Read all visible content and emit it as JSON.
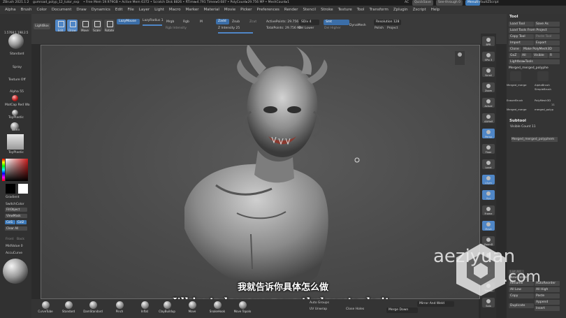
{
  "titlebar": {
    "app": "ZBrush 2021.1.2",
    "file": "gumroad_polyp_12_tutor_exp",
    "stats": "• Free Mem 19.979GB • Active Mem 6372 • Scratch Disk 8826 • RTime▸4.791 Timer▸0.687 • PolyCount▸29.756 MP • MeshCount▸1",
    "ac": "AC",
    "quicksave": "QuickSave",
    "seethrough": "See-through 0",
    "menus": "Menus",
    "defaultscript": "DefaultZScript"
  },
  "menubar": [
    "Alpha",
    "Brush",
    "Color",
    "Document",
    "Draw",
    "Dynamics",
    "Edit",
    "File",
    "Layer",
    "Light",
    "Macro",
    "Marker",
    "Material",
    "Movie",
    "Picker",
    "Preferences",
    "Render",
    "Stencil",
    "Stroke",
    "Texture",
    "Tool",
    "Transform",
    "Zplugin",
    "Zscript",
    "Help"
  ],
  "shelf": {
    "projection_master": "Projection Master",
    "lightbox": "LightBox",
    "edit": "Edit",
    "draw": "Draw",
    "move": "Move",
    "scale": "Scale",
    "rotate": "Rotate",
    "lazymouse": "LazyMouse",
    "lazyradius": "LazyRadius 1",
    "mrgb": "Mrgb",
    "rgb": "Rgb",
    "m": "M",
    "zadd": "Zadd",
    "zsub": "Zsub",
    "zcut": "Zcut",
    "z_intensity": "Z Intensity 25",
    "rgb_intensity": "Rgb Intensity",
    "activepoints": "ActivePoints: 29.756 Mil",
    "totalpoints": "TotalPoints: 29.756 Mil",
    "divide": "Divide",
    "sdiv": "SDiv 4",
    "del_lower": "Del Lower",
    "smt": "Smt",
    "del_higher": "Del Higher",
    "dynamesh": "DynaMesh",
    "resolution": "Resolution 128",
    "polish": "Polish",
    "project": "Project"
  },
  "lefttray": {
    "brush": "Standard",
    "stroke": "Spray",
    "texture": "Texture Off",
    "alpha": "Alpha 55",
    "material": "MatCap Red Wa",
    "material2": "ToyPlastic",
    "material3": "Blinn",
    "gradient": "Gradient",
    "switchcolor": "SwitchColor",
    "alternate": "Alternate",
    "fillobject": "FillObject",
    "viewmask": "ViewMask",
    "color1": "Col1",
    "color2": "Col2",
    "clear_all": "Clear All",
    "front": "Front",
    "back": "Back",
    "midvalue": "MidValue 0",
    "accucurve": "AccuCurve",
    "ratio": "1.5768:1  198.2.5",
    "colors": {
      "main": "#cc1d1d",
      "secondary": "#ffffff"
    }
  },
  "rightstrip": [
    "BPR",
    "SPix 3",
    "Scroll",
    "Zoom",
    "Actual",
    "AAHalf",
    "Persp",
    "Floor",
    "Local",
    "LSym",
    "Xyz",
    "Frame",
    "Move",
    "ZoomD",
    "RotaTe",
    "PolyF",
    "Transp",
    "Solo"
  ],
  "rightpanel": {
    "header": "Tool",
    "load_tool": "Load Tool",
    "save_as": "Save As",
    "load_tools_from_project": "Load Tools From Project",
    "copy_tool": "Copy Tool",
    "paste_tool": "Paste Tool",
    "import": "Import",
    "export": "Export",
    "clone": "Clone",
    "make_polymesh3d": "Make PolyMesh3D",
    "goz": "GoZ",
    "all": "All",
    "visible": "Visible",
    "r": "R",
    "lightbox_tools": "Lightbox▸Tools",
    "current_tool": "Merged_merged_polyphe",
    "tool_thumbs": [
      "Merged_merge",
      "AlphaBrush",
      "SimpleBrush",
      "EraserBrush",
      "PolyMesh3D",
      "Merged_merge",
      "merged_polyp"
    ],
    "thumb_count": "11",
    "subtool_header": "Subtool",
    "visible_count": "Visible Count 11",
    "subtool_item": "Merged_merged_polyphem",
    "lower": {
      "list_all": "List All",
      "new_folder": "New Folder",
      "rename": "Rename",
      "auto_reorder": "AutoReorder",
      "all_low": "All Low",
      "all_high": "All High",
      "copy": "Copy",
      "paste": "Paste",
      "duplicate": "Duplicate",
      "append": "Append",
      "insert": "Insert"
    }
  },
  "bottombar": {
    "brushes": [
      "CurveTube",
      "Standard",
      "DamStandard",
      "Pinch",
      "Inflat",
      "ClayBuildup",
      "Move",
      "SnakeHook",
      "Move Topolo"
    ],
    "auto_groups": "Auto Groups",
    "uv_unwrap": "UV Unwrap",
    "close_holes": "Close Holes",
    "merge_down": "Merge Down",
    "mirror_and_weld": "Mirror And Weld"
  },
  "subtitles": {
    "cn": "我就告诉你具体怎么做",
    "en": "I'll just show you exactly how to do it."
  },
  "watermark": {
    "text": "aeziyuan",
    "suffix": ".com"
  }
}
